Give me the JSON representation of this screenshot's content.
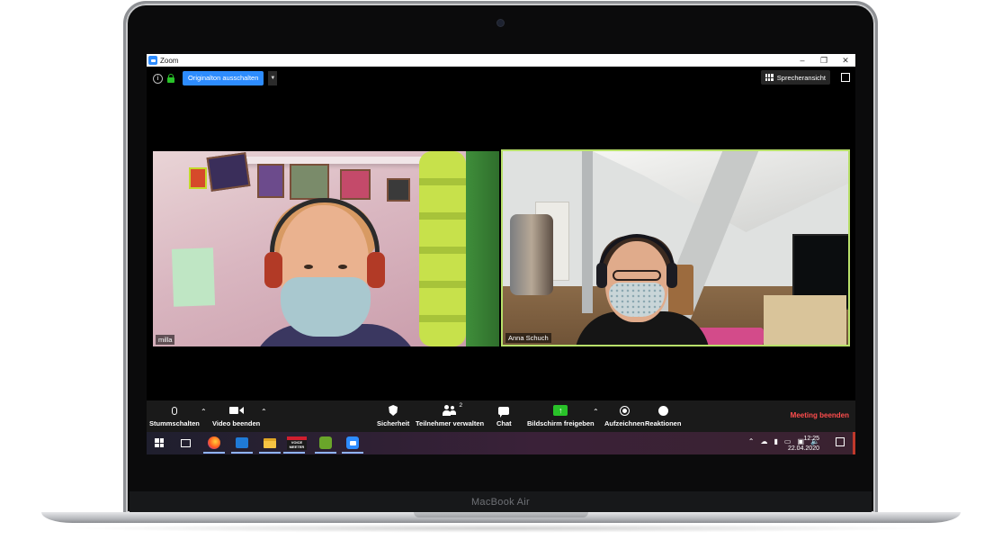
{
  "laptop": {
    "brand": "MacBook Air"
  },
  "window": {
    "title": "Zoom",
    "controls": [
      "–",
      "❐",
      "✕"
    ]
  },
  "top_bar": {
    "original_sound_button": "Originalton ausschalten",
    "speaker_view_button": "Sprecheransicht"
  },
  "videos": [
    {
      "name": "milla"
    },
    {
      "name": "Anna Schuch"
    }
  ],
  "toolbar": {
    "mute_label": "Stummschalten",
    "video_label": "Video beenden",
    "security_label": "Sicherheit",
    "participants_label": "Teilnehmer verwalten",
    "participants_count": "2",
    "chat_label": "Chat",
    "share_label": "Bildschirm freigeben",
    "record_label": "Aufzeichnen",
    "reactions_label": "Reaktionen",
    "end_meeting_label": "Meeting beenden"
  },
  "taskbar": {
    "time": "12:25",
    "date": "22.04.2020",
    "voicemeeter_label": "VOICE MEETER",
    "icons": [
      "windows-start-icon",
      "task-view-icon",
      "firefox-icon",
      "outlook-icon",
      "file-explorer-icon",
      "voicemeeter-icon",
      "app-icon",
      "zoom-icon"
    ]
  },
  "colors": {
    "zoom_blue": "#2d8cff",
    "active_speaker_border": "#b8e06a",
    "end_meeting": "#ff4d4d",
    "share_green": "#29c229"
  }
}
